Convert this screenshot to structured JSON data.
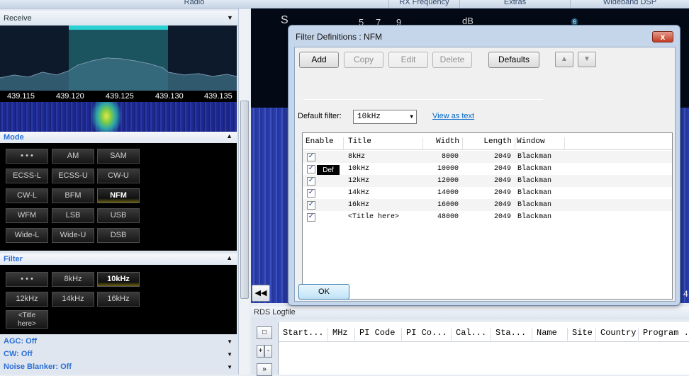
{
  "top_tabs": [
    "Radio",
    "RX Frequency",
    "Extras",
    "Wideband DSP"
  ],
  "receive_panel": {
    "title": "Receive",
    "freq_ticks": [
      "439.115",
      "439.120",
      "439.125",
      "439.130",
      "439.135"
    ]
  },
  "mode": {
    "title": "Mode",
    "buttons": [
      "• • •",
      "AM",
      "SAM",
      "ECSS-L",
      "ECSS-U",
      "CW-U",
      "CW-L",
      "BFM",
      "NFM",
      "WFM",
      "LSB",
      "USB",
      "Wide-L",
      "Wide-U",
      "DSB"
    ],
    "active": "NFM"
  },
  "filter": {
    "title": "Filter",
    "buttons": [
      "• • •",
      "8kHz",
      "10kHz",
      "12kHz",
      "14kHz",
      "16kHz"
    ],
    "title_button": [
      "<Title",
      "here>"
    ],
    "active": "10kHz"
  },
  "status_lines": [
    "AGC: Off",
    "CW: Off",
    "Noise Blanker: Off"
  ],
  "main": {
    "meter_s": "S",
    "meter_nums": [
      "5",
      "7",
      "9"
    ],
    "meter_db": "dB",
    "meter_marker": "6",
    "right_edge_label": "4"
  },
  "rds": {
    "title": "RDS Logfile",
    "columns": [
      "Start...",
      "MHz",
      "PI Code",
      "PI Co...",
      "Cal...",
      "Sta...",
      "Name",
      "Site",
      "Country",
      "Program ."
    ],
    "side_buttons": [
      "□",
      "+",
      "-",
      "»"
    ]
  },
  "dialog": {
    "title": "Filter Definitions : NFM",
    "close": "x",
    "buttons": {
      "add": "Add",
      "copy": "Copy",
      "edit": "Edit",
      "delete": "Delete",
      "defaults": "Defaults"
    },
    "up_icon": "up-arrow-icon",
    "down_icon": "down-arrow-icon",
    "default_filter_label": "Default filter:",
    "default_filter_value": "10kHz",
    "view_as_text": "View as text",
    "columns": [
      "Enable",
      "Title",
      "Width",
      "Length",
      "Window"
    ],
    "rows": [
      {
        "title": "8kHz",
        "width": "8000",
        "length": "2049",
        "window": "Blackman",
        "def": ""
      },
      {
        "title": "10kHz",
        "width": "10000",
        "length": "2049",
        "window": "Blackman",
        "def": "Def"
      },
      {
        "title": "12kHz",
        "width": "12000",
        "length": "2049",
        "window": "Blackman",
        "def": ""
      },
      {
        "title": "14kHz",
        "width": "14000",
        "length": "2049",
        "window": "Blackman",
        "def": ""
      },
      {
        "title": "16kHz",
        "width": "16000",
        "length": "2049",
        "window": "Blackman",
        "def": ""
      },
      {
        "title": "<Title here>",
        "width": "48000",
        "length": "2049",
        "window": "Blackman",
        "def": ""
      }
    ],
    "ok": "OK"
  }
}
